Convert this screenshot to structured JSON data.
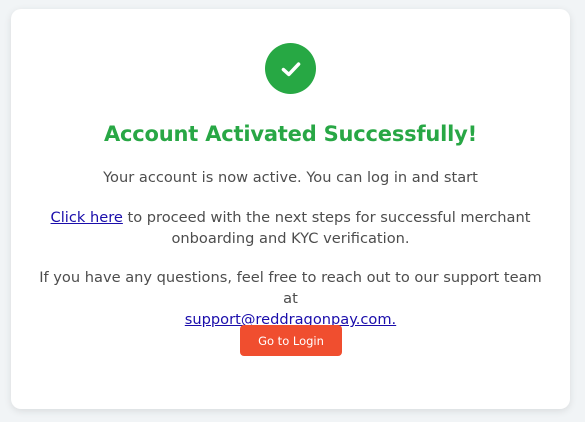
{
  "header": {
    "icon": "check-circle-icon",
    "title": "Account Activated Successfully!"
  },
  "body": {
    "status_text": "Your account is now active. You can log in and start",
    "link_text": "Click here",
    "link_suffix": " to proceed with the next steps for successful merchant onboarding and KYC verification.",
    "questions_text": "If you have any questions, feel free to reach out to our support team at",
    "support_email": "support@reddragonpay.com."
  },
  "actions": {
    "login_label": "Go to Login"
  },
  "colors": {
    "success": "#28a745",
    "button": "#f04e2f",
    "link": "#1a0dab"
  }
}
